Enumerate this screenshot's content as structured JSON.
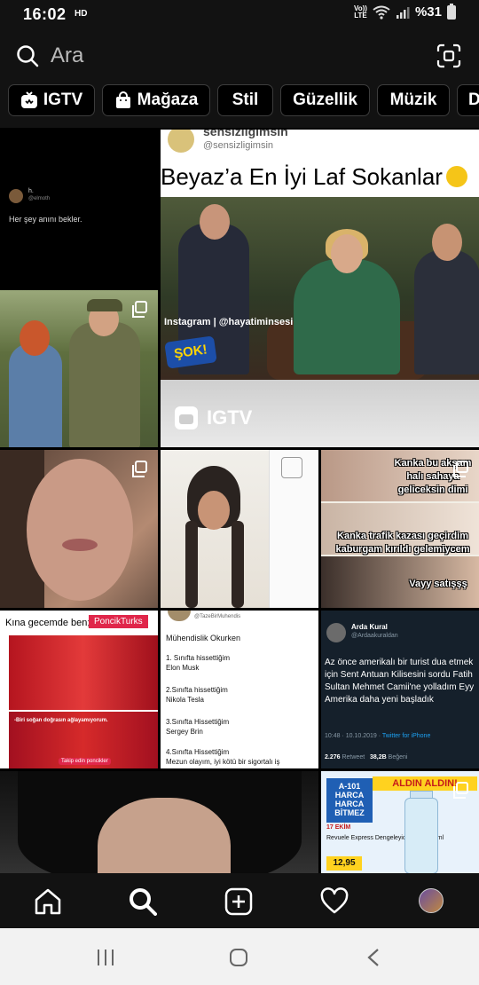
{
  "status": {
    "time": "16:02",
    "hd": "HD",
    "lte_top": "Vo))",
    "lte_bottom": "LTE",
    "battery": "%31"
  },
  "search": {
    "placeholder": "Ara"
  },
  "chips": [
    {
      "label": "IGTV",
      "icon": "igtv-icon"
    },
    {
      "label": "Mağaza",
      "icon": "shopping-bag-icon"
    },
    {
      "label": "Stil"
    },
    {
      "label": "Güzellik"
    },
    {
      "label": "Müzik"
    },
    {
      "label": "D"
    }
  ],
  "grid": {
    "tweet1": {
      "handle": "h.",
      "handle2": "@elmoth",
      "text": "Her şey anını bekler."
    },
    "igtv": {
      "account": "sensizligimsin",
      "account_handle": "@sensizligimsin",
      "headline": "Beyaz’a En İyi Laf Sokanlar",
      "credit": "Instagram | @hayatiminsesi",
      "logo": "ŞOK!",
      "label": "IGTV"
    },
    "meme_right": {
      "cap1": "Kanka bu akşam halı sahaya geliceksin dimi",
      "cap2": "Kanka trafik kazası geçirdim kaburgam kırıldı gelemiycem",
      "cap3": "Vayy satışşş"
    },
    "poncik": {
      "title": "Kına gecemde ben;",
      "badge": "PoncikTurks",
      "sub": "-Biri soğan doğrasın ağlayamıyorum.",
      "takip": "Takip edin poncikler"
    },
    "muh": {
      "handle": "@TazeBirMuhendis",
      "title": "Mühendislik Okurken",
      "items": [
        "1. Sınıfta hissettiğim",
        "Elon Musk",
        "2.Sınıfta hissettiğim",
        "Nikola Tesla",
        "3.Sınıfta Hissettiğim",
        "Sergey Brin",
        "4.Sınıfta Hissettiğim",
        "Mezun olayım, iyi kötü bir sigortalı iş"
      ]
    },
    "arda": {
      "name": "Arda Kural",
      "handle": "@Ardaakuraldan",
      "body": "Az önce amerikalı bir turist dua etmek için Sent Antuan Kilisesini sordu Fatih Sultan Mehmet Camii'ne yolladım Eyy Amerika daha yeni başladık",
      "meta_time": "10:48 · 10.10.2019 · ",
      "meta_link": "Twitter for iPhone",
      "retweets": "2.276",
      "retweets_label": "Retweet",
      "likes": "38,2B",
      "likes_label": "Beğeni"
    },
    "a101": {
      "brand": "A-101 HARCA HARCA BİTMEZ",
      "aldin": "ALDIN ALDIN!",
      "ekim": "17 EKİM",
      "product": "Revuele Express Dengeleyici Tonik 250 ml",
      "price": "12,95"
    }
  },
  "nav": [
    "home-icon",
    "search-icon",
    "new-post-icon",
    "activity-heart-icon",
    "profile-avatar"
  ]
}
